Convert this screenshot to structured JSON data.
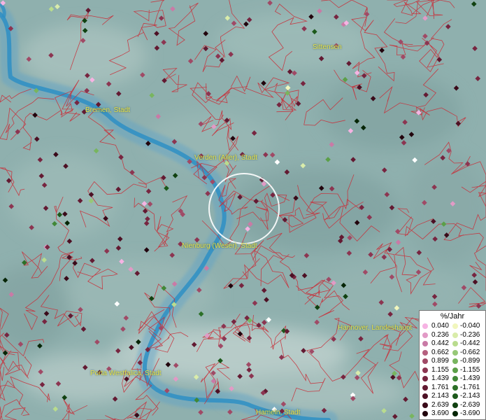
{
  "map": {
    "cities": [
      {
        "id": "sittensen",
        "name": "Sittensen"
      },
      {
        "id": "bremen",
        "name": "Bremen, Stadt"
      },
      {
        "id": "verden",
        "name": "Verden (Aller), Stadt"
      },
      {
        "id": "nienburg",
        "name": "Nienburg (Weser), Stadt"
      },
      {
        "id": "hannover",
        "name": "Hannover, Landeshaupt"
      },
      {
        "id": "porta",
        "name": "Porta Westfalica, Stadt"
      },
      {
        "id": "hameln",
        "name": "Hameln, Stadt"
      }
    ],
    "colors": {
      "river": "#2e8fc4",
      "borders": "#c8303a",
      "labels": "#e7e24a"
    }
  },
  "legend": {
    "title": "%/Jahr",
    "positive": [
      {
        "value": "0.040",
        "color": "#f6b3e3"
      },
      {
        "value": "0.236",
        "color": "#e29ac6"
      },
      {
        "value": "0.442",
        "color": "#c97aa6"
      },
      {
        "value": "0.662",
        "color": "#b5607f"
      },
      {
        "value": "0.899",
        "color": "#a04a66"
      },
      {
        "value": "1.155",
        "color": "#8c3551"
      },
      {
        "value": "1.439",
        "color": "#772540"
      },
      {
        "value": "1.761",
        "color": "#631a32"
      },
      {
        "value": "2.143",
        "color": "#4d1024"
      },
      {
        "value": "2.639",
        "color": "#3a0a19"
      },
      {
        "value": "3.690",
        "color": "#22040d"
      }
    ],
    "negative": [
      {
        "value": "-0.040",
        "color": "#f1f6bd"
      },
      {
        "value": "-0.236",
        "color": "#d9ecaa"
      },
      {
        "value": "-0.442",
        "color": "#b9dc8e"
      },
      {
        "value": "-0.662",
        "color": "#97c877"
      },
      {
        "value": "-0.899",
        "color": "#78b55f"
      },
      {
        "value": "-1.155",
        "color": "#5b9f48"
      },
      {
        "value": "-1.439",
        "color": "#418837"
      },
      {
        "value": "-1.761",
        "color": "#2c7027"
      },
      {
        "value": "-2.143",
        "color": "#1c591b"
      },
      {
        "value": "-2.639",
        "color": "#104110"
      },
      {
        "value": "-3.690",
        "color": "#062506"
      }
    ]
  }
}
